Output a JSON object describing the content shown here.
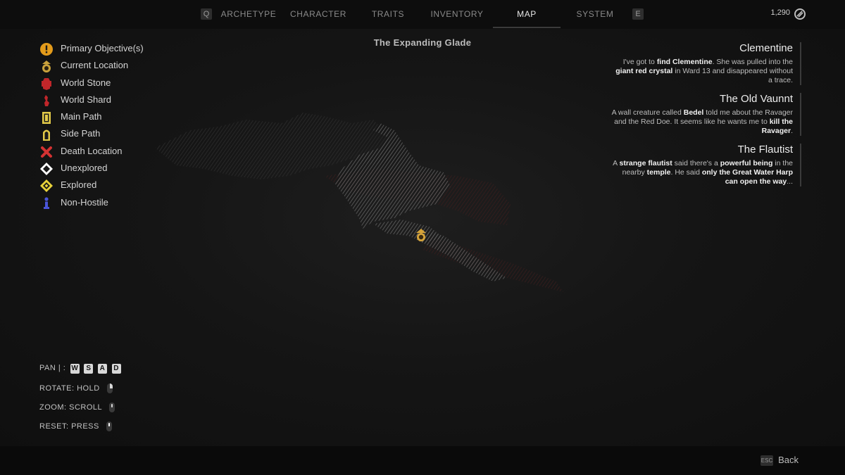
{
  "nav": {
    "left_key": "Q",
    "right_key": "E",
    "tabs": [
      {
        "label": "ARCHETYPE"
      },
      {
        "label": "CHARACTER"
      },
      {
        "label": "TRAITS"
      },
      {
        "label": "INVENTORY"
      },
      {
        "label": "MAP"
      },
      {
        "label": "SYSTEM"
      }
    ],
    "active_tab": "MAP",
    "currency": "1,290"
  },
  "map": {
    "title": "The Expanding Glade"
  },
  "legend": [
    {
      "label": "Primary Objective(s)",
      "icon": "exclamation-icon",
      "color": "#e39b1b"
    },
    {
      "label": "Current Location",
      "icon": "current-location-icon",
      "color": "#c9a23c"
    },
    {
      "label": "World Stone",
      "icon": "world-stone-icon",
      "color": "#c0262a"
    },
    {
      "label": "World Shard",
      "icon": "world-shard-icon",
      "color": "#c0262a"
    },
    {
      "label": "Main Path",
      "icon": "main-path-icon",
      "color": "#e2c948"
    },
    {
      "label": "Side Path",
      "icon": "side-path-icon",
      "color": "#e2c948"
    },
    {
      "label": "Death Location",
      "icon": "death-x-icon",
      "color": "#d43232"
    },
    {
      "label": "Unexplored",
      "icon": "unexplored-diamond-icon",
      "color": "#ffffff"
    },
    {
      "label": "Explored",
      "icon": "explored-diamond-icon",
      "color": "#e8d23a"
    },
    {
      "label": "Non-Hostile",
      "icon": "non-hostile-icon",
      "color": "#4a55d8"
    }
  ],
  "quests": [
    {
      "title": "Clementine",
      "desc": [
        {
          "t": "I've got to ",
          "b": false
        },
        {
          "t": "find Clementine",
          "b": true
        },
        {
          "t": ". She was pulled into the ",
          "b": false
        },
        {
          "t": "giant red crystal",
          "b": true
        },
        {
          "t": " in Ward 13 and disappeared without a trace.",
          "b": false
        }
      ]
    },
    {
      "title": "The Old Vaunnt",
      "desc": [
        {
          "t": "A wall creature called ",
          "b": false
        },
        {
          "t": "Bedel",
          "b": true
        },
        {
          "t": " told me about the Ravager and the Red Doe. It seems like he wants me to ",
          "b": false
        },
        {
          "t": "kill the Ravager",
          "b": true
        },
        {
          "t": ".",
          "b": false
        }
      ]
    },
    {
      "title": "The Flautist",
      "desc": [
        {
          "t": "A ",
          "b": false
        },
        {
          "t": "strange flautist",
          "b": true
        },
        {
          "t": " said there's a ",
          "b": false
        },
        {
          "t": "powerful being",
          "b": true
        },
        {
          "t": " in the nearby ",
          "b": false
        },
        {
          "t": "temple",
          "b": true
        },
        {
          "t": ". He said ",
          "b": false
        },
        {
          "t": "only the Great Water Harp can open the way",
          "b": true
        },
        {
          "t": "...",
          "b": false
        }
      ]
    }
  ],
  "controls": {
    "pan_label": "PAN | :",
    "pan_keys": [
      "W",
      "S",
      "A",
      "D"
    ],
    "rotate_label": "ROTATE: HOLD",
    "zoom_label": "ZOOM: SCROLL",
    "reset_label": "RESET: PRESS"
  },
  "footer": {
    "esc_key": "ESC",
    "back_label": "Back"
  }
}
